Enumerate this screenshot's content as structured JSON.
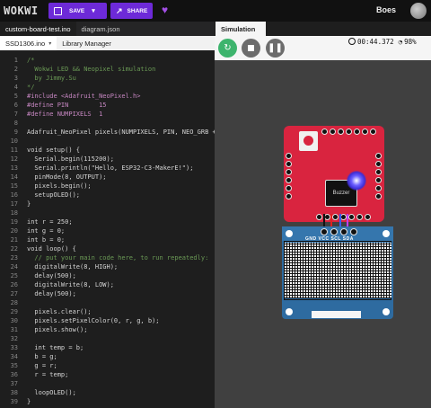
{
  "header": {
    "logo": "WOKWI",
    "save_label": "SAVE",
    "share_label": "SHARE",
    "user_name": "Boes"
  },
  "editor": {
    "tabs": [
      {
        "label": "custom-board-test.ino"
      },
      {
        "label": "diagram.json"
      }
    ],
    "subtabs": [
      {
        "label": "SSD1306.ino"
      },
      {
        "label": "Library Manager"
      }
    ],
    "lines": [
      {
        "n": "1",
        "t": "/*"
      },
      {
        "n": "2",
        "t": "  Wokwi LED && Neopixel simulation"
      },
      {
        "n": "3",
        "t": "  by Jimmy.Su"
      },
      {
        "n": "4",
        "t": "*/"
      },
      {
        "n": "5",
        "t": "#include <Adafruit_NeoPixel.h>"
      },
      {
        "n": "6",
        "t": "#define PIN        15"
      },
      {
        "n": "7",
        "t": "#define NUMPIXELS  1"
      },
      {
        "n": "8",
        "t": ""
      },
      {
        "n": "9",
        "t": "Adafruit_NeoPixel pixels(NUMPIXELS, PIN, NEO_GRB + N"
      },
      {
        "n": "10",
        "t": ""
      },
      {
        "n": "11",
        "t": "void setup() {"
      },
      {
        "n": "12",
        "t": "  Serial.begin(115200);"
      },
      {
        "n": "13",
        "t": "  Serial.println(\"Hello, ESP32-C3-MakerE!\");"
      },
      {
        "n": "14",
        "t": "  pinMode(8, OUTPUT);"
      },
      {
        "n": "15",
        "t": "  pixels.begin();"
      },
      {
        "n": "16",
        "t": "  setupOLED();"
      },
      {
        "n": "17",
        "t": "}"
      },
      {
        "n": "18",
        "t": ""
      },
      {
        "n": "19",
        "t": "int r = 250;"
      },
      {
        "n": "20",
        "t": "int g = 0;"
      },
      {
        "n": "21",
        "t": "int b = 0;"
      },
      {
        "n": "22",
        "t": "void loop() {"
      },
      {
        "n": "23",
        "t": "  // put your main code here, to run repeatedly:"
      },
      {
        "n": "24",
        "t": "  digitalWrite(8, HIGH);"
      },
      {
        "n": "25",
        "t": "  delay(500);"
      },
      {
        "n": "26",
        "t": "  digitalWrite(8, LOW);"
      },
      {
        "n": "27",
        "t": "  delay(500);"
      },
      {
        "n": "28",
        "t": ""
      },
      {
        "n": "29",
        "t": "  pixels.clear();"
      },
      {
        "n": "30",
        "t": "  pixels.setPixelColor(0, r, g, b);"
      },
      {
        "n": "31",
        "t": "  pixels.show();"
      },
      {
        "n": "32",
        "t": ""
      },
      {
        "n": "33",
        "t": "  int temp = b;"
      },
      {
        "n": "34",
        "t": "  b = g;"
      },
      {
        "n": "35",
        "t": "  g = r;"
      },
      {
        "n": "36",
        "t": "  r = temp;"
      },
      {
        "n": "37",
        "t": ""
      },
      {
        "n": "38",
        "t": "  loopOLED();"
      },
      {
        "n": "39",
        "t": "}"
      }
    ]
  },
  "simulation": {
    "tab_label": "Simulation",
    "time": "00:44.372",
    "cpu": "98%",
    "buzzer_label": "Buzzer",
    "oled_pins": "GND VCC SCL SDA",
    "colors": {
      "start": "#3db46d",
      "board": "#d9243f",
      "oled": "#2e6ba0",
      "led": "#4a3cff"
    }
  }
}
